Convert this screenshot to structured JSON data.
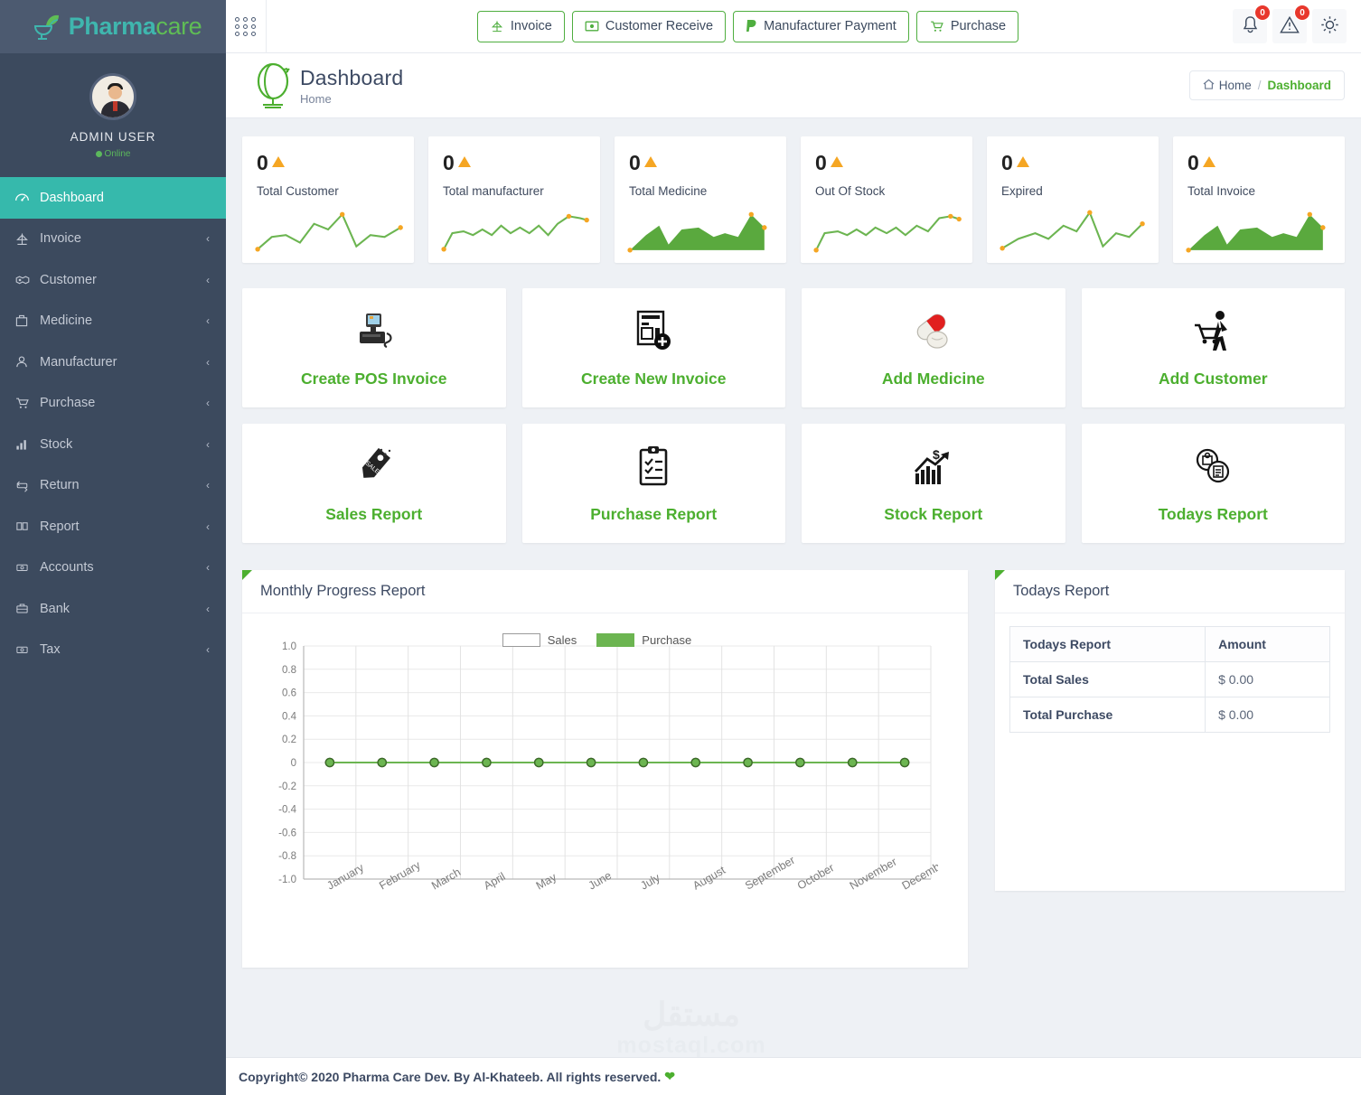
{
  "brand": {
    "part1": "Pharma",
    "part2": "care",
    "logo_icon": "mortar-pestle-leaf-icon"
  },
  "profile": {
    "name": "ADMIN USER",
    "status": "Online",
    "avatar_icon": "user-avatar"
  },
  "sidebar": {
    "items": [
      {
        "label": "Dashboard",
        "icon": "speedometer-icon",
        "active": true,
        "caret": ""
      },
      {
        "label": "Invoice",
        "icon": "scales-icon",
        "active": false,
        "caret": "‹"
      },
      {
        "label": "Customer",
        "icon": "handshake-icon",
        "active": false,
        "caret": "‹"
      },
      {
        "label": "Medicine",
        "icon": "medkit-icon",
        "active": false,
        "caret": "‹"
      },
      {
        "label": "Manufacturer",
        "icon": "person-icon",
        "active": false,
        "caret": "‹"
      },
      {
        "label": "Purchase",
        "icon": "cart-icon",
        "active": false,
        "caret": "‹"
      },
      {
        "label": "Stock",
        "icon": "bar-chart-icon",
        "active": false,
        "caret": "‹"
      },
      {
        "label": "Return",
        "icon": "return-arrow-icon",
        "active": false,
        "caret": "‹"
      },
      {
        "label": "Report",
        "icon": "book-icon",
        "active": false,
        "caret": "‹"
      },
      {
        "label": "Accounts",
        "icon": "banknote-icon",
        "active": false,
        "caret": "‹"
      },
      {
        "label": "Bank",
        "icon": "briefcase-icon",
        "active": false,
        "caret": "‹"
      },
      {
        "label": "Tax",
        "icon": "money-icon",
        "active": false,
        "caret": "‹"
      }
    ]
  },
  "topbar": {
    "grid_toggle_icon": "grid-dots-icon",
    "buttons": [
      {
        "label": "Invoice",
        "icon": "scales-icon"
      },
      {
        "label": "Customer Receive",
        "icon": "cash-icon"
      },
      {
        "label": "Manufacturer Payment",
        "icon": "paypal-icon"
      },
      {
        "label": "Purchase",
        "icon": "cart-icon"
      }
    ],
    "notifications": {
      "icon": "bell-icon",
      "badge": "0"
    },
    "alerts": {
      "icon": "warning-icon",
      "badge": "0"
    },
    "settings": {
      "icon": "gear-icon"
    }
  },
  "pagehead": {
    "icon": "globe-icon",
    "title": "Dashboard",
    "subtitle": "Home",
    "breadcrumb": {
      "home": "Home",
      "separator": "/",
      "current": "Dashboard",
      "home_icon": "home-icon"
    }
  },
  "stats": [
    {
      "value": "0",
      "label": "Total Customer",
      "trend_icon": "triangle-up-icon",
      "spark_type": "line"
    },
    {
      "value": "0",
      "label": "Total manufacturer",
      "trend_icon": "triangle-up-icon",
      "spark_type": "line"
    },
    {
      "value": "0",
      "label": "Total Medicine",
      "trend_icon": "triangle-up-icon",
      "spark_type": "area"
    },
    {
      "value": "0",
      "label": "Out Of Stock",
      "trend_icon": "triangle-up-icon",
      "spark_type": "line"
    },
    {
      "value": "0",
      "label": "Expired",
      "trend_icon": "triangle-up-icon",
      "spark_type": "line"
    },
    {
      "value": "0",
      "label": "Total Invoice",
      "trend_icon": "triangle-up-icon",
      "spark_type": "area"
    }
  ],
  "tiles": [
    {
      "label": "Create POS Invoice",
      "icon": "pos-terminal-icon"
    },
    {
      "label": "Create New Invoice",
      "icon": "invoice-add-icon"
    },
    {
      "label": "Add Medicine",
      "icon": "pills-icon"
    },
    {
      "label": "Add Customer",
      "icon": "shopper-icon"
    },
    {
      "label": "Sales Report",
      "icon": "sale-tag-icon"
    },
    {
      "label": "Purchase Report",
      "icon": "clipboard-check-icon"
    },
    {
      "label": "Stock Report",
      "icon": "growth-chart-icon"
    },
    {
      "label": "Todays Report",
      "icon": "documents-icon"
    }
  ],
  "chart_panel": {
    "title": "Monthly Progress Report"
  },
  "today_panel": {
    "title": "Todays Report",
    "columns": [
      "Todays Report",
      "Amount"
    ],
    "rows": [
      {
        "key": "Total Sales",
        "value": "$ 0.00"
      },
      {
        "key": "Total Purchase",
        "value": "$ 0.00"
      }
    ]
  },
  "chart_data": {
    "type": "line",
    "title": "Monthly Progress Report",
    "xlabel": "",
    "ylabel": "",
    "grid": true,
    "legend_position": "top-center",
    "categories": [
      "January",
      "February",
      "March",
      "April",
      "May",
      "June",
      "July",
      "August",
      "September",
      "October",
      "November",
      "December"
    ],
    "ylim": [
      -1.0,
      1.0
    ],
    "yticks": [
      "1.0",
      "0.8",
      "0.6",
      "0.4",
      "0.2",
      "0",
      "-0.2",
      "-0.4",
      "-0.6",
      "-0.8",
      "-1.0"
    ],
    "series": [
      {
        "name": "Sales",
        "color": "#ffffff",
        "values": [
          0,
          0,
          0,
          0,
          0,
          0,
          0,
          0,
          0,
          0,
          0,
          0
        ]
      },
      {
        "name": "Purchase",
        "color": "#6cb551",
        "values": [
          0,
          0,
          0,
          0,
          0,
          0,
          0,
          0,
          0,
          0,
          0,
          0
        ]
      }
    ]
  },
  "footer": {
    "text": "Copyright© 2020 Pharma Care Dev. By Al-Khateeb. All rights reserved.",
    "heart_icon": "heart-icon"
  },
  "watermark": {
    "arabic": "مستقل",
    "latin": "mostaql.com"
  },
  "colors": {
    "accent_green": "#4caf2f",
    "teal": "#36b9ac",
    "sidebar": "#3c4a5e",
    "orange": "#f5a623",
    "badge_red": "#e8372c"
  }
}
